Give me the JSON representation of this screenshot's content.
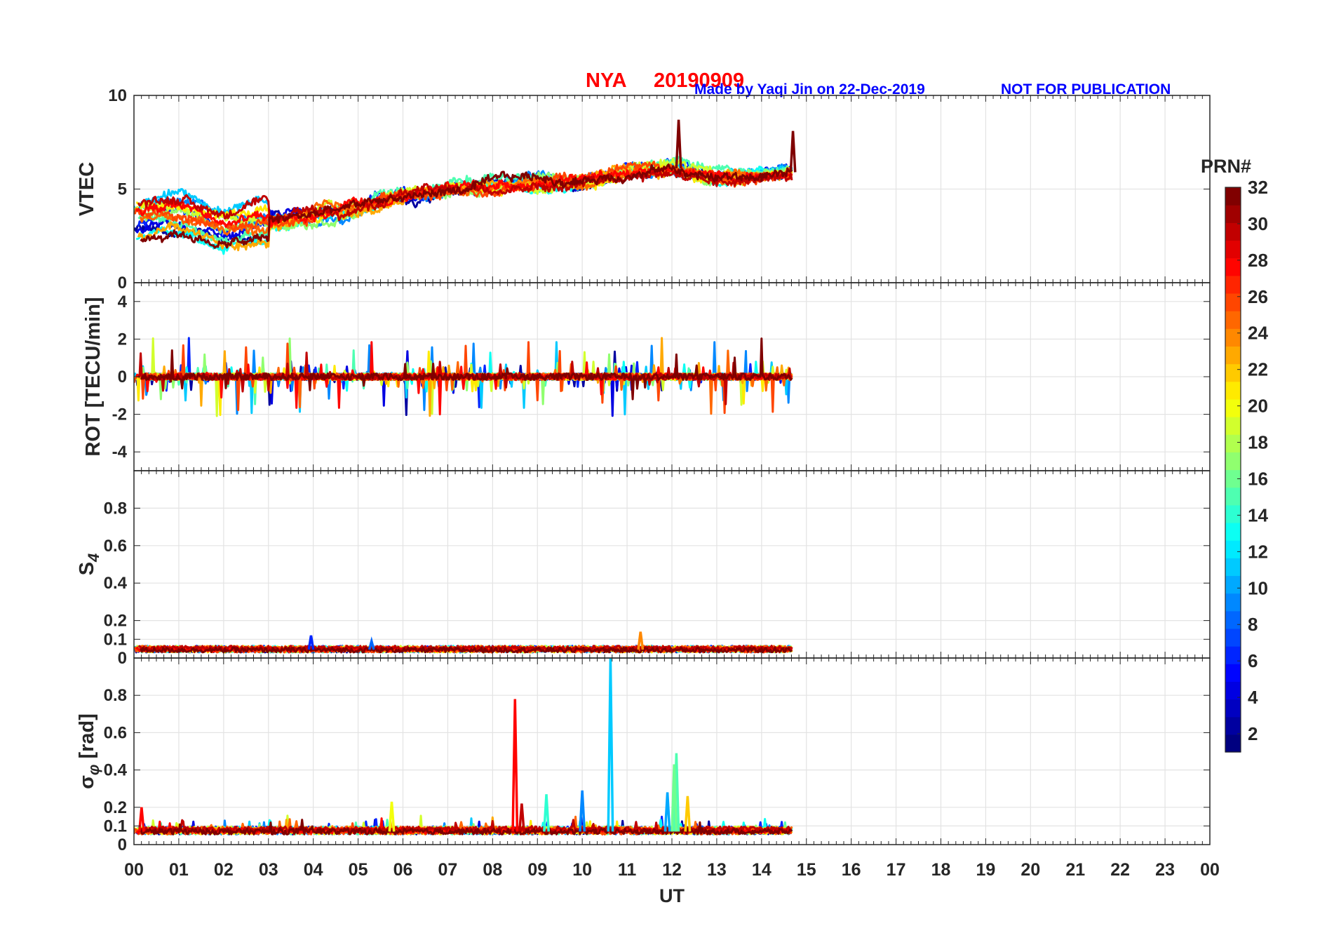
{
  "header": {
    "station": "NYA",
    "date": "20190909",
    "credit": "Made by Yaqi Jin on 22-Dec-2019",
    "notice": "NOT FOR PUBLICATION"
  },
  "colors": {
    "station_title": "#ff0000",
    "credit_text": "#0000ff",
    "grid": "#e3e3e3",
    "axes": "#262626"
  },
  "colorbar": {
    "label": "PRN#",
    "colormap": "jet",
    "range": [
      1,
      32
    ],
    "ticks": [
      "2",
      "4",
      "6",
      "8",
      "10",
      "12",
      "14",
      "16",
      "18",
      "20",
      "22",
      "24",
      "26",
      "28",
      "30",
      "32"
    ]
  },
  "chart_data": [
    {
      "type": "line",
      "ylabel": "VTEC",
      "ylim": [
        0,
        10
      ],
      "yticks": [
        "0",
        "5",
        "10"
      ],
      "xlim": [
        0,
        24
      ],
      "grid": true,
      "data_extent_hours": [
        0,
        14.7
      ],
      "series_summary": "multiple PRN traces colored by PRN number",
      "trend": [
        [
          0,
          3.5
        ],
        [
          1,
          3.7
        ],
        [
          2,
          3.0
        ],
        [
          3,
          3.2
        ],
        [
          4,
          3.6
        ],
        [
          5,
          4.0
        ],
        [
          6,
          4.6
        ],
        [
          7,
          4.9
        ],
        [
          8,
          5.2
        ],
        [
          9,
          5.5
        ],
        [
          10,
          5.4
        ],
        [
          11,
          6.0
        ],
        [
          12,
          6.2
        ],
        [
          13,
          5.6
        ],
        [
          14,
          5.7
        ],
        [
          14.7,
          5.9
        ]
      ],
      "annotations": [
        {
          "x": 12.15,
          "y": 8.7,
          "prn": 32
        },
        {
          "x": 14.7,
          "y": 8.1,
          "prn": 32
        }
      ]
    },
    {
      "type": "line",
      "ylabel": "ROT [TECU/min]",
      "ylim": [
        -5,
        5
      ],
      "yticks": [
        "-4",
        "-2",
        "0",
        "2",
        "4"
      ],
      "xlim": [
        0,
        24
      ],
      "grid": true,
      "data_extent_hours": [
        0,
        14.7
      ],
      "series_summary": "noise around 0 with spikes up to about ±3 TECU/min"
    },
    {
      "type": "line",
      "ylabel": "S",
      "ylabel_subscript": "4",
      "ylim": [
        0,
        1
      ],
      "yticks": [
        "0",
        "0.1",
        "0.2",
        "0.4",
        "0.6",
        "0.8"
      ],
      "xlim": [
        0,
        24
      ],
      "grid": true,
      "data_extent_hours": [
        0,
        14.7
      ],
      "series_summary": "baseline about 0.03-0.06",
      "peaks": [
        {
          "x": 3.95,
          "y": 0.12,
          "prn": 6
        },
        {
          "x": 5.3,
          "y": 0.09,
          "prn": 8
        },
        {
          "x": 11.3,
          "y": 0.14,
          "prn": 24
        }
      ]
    },
    {
      "type": "line",
      "ylabel": "σ",
      "ylabel_subscript": "φ",
      "ylabel_suffix": "[rad]",
      "ylim": [
        0,
        1
      ],
      "yticks": [
        "0",
        "0.1",
        "0.2",
        "0.4",
        "0.6",
        "0.8"
      ],
      "xlim": [
        0,
        24
      ],
      "grid": true,
      "data_extent_hours": [
        0,
        14.7
      ],
      "series_summary": "baseline about 0.05-0.08",
      "peaks": [
        {
          "x": 8.5,
          "y": 0.78,
          "prn": 28
        },
        {
          "x": 10.63,
          "y": 1.0,
          "prn": 11
        },
        {
          "x": 12.1,
          "y": 0.49,
          "prn": 15
        },
        {
          "x": 12.05,
          "y": 0.43,
          "prn": 16
        },
        {
          "x": 8.65,
          "y": 0.22,
          "prn": 30
        },
        {
          "x": 9.2,
          "y": 0.27,
          "prn": 14
        },
        {
          "x": 10.0,
          "y": 0.29,
          "prn": 9
        },
        {
          "x": 11.9,
          "y": 0.28,
          "prn": 10
        },
        {
          "x": 12.35,
          "y": 0.26,
          "prn": 22
        },
        {
          "x": 5.75,
          "y": 0.23,
          "prn": 20
        },
        {
          "x": 0.17,
          "y": 0.2,
          "prn": 28
        }
      ]
    }
  ],
  "xaxis": {
    "label": "UT",
    "ticks": [
      "00",
      "01",
      "02",
      "03",
      "04",
      "05",
      "06",
      "07",
      "08",
      "09",
      "10",
      "11",
      "12",
      "13",
      "14",
      "15",
      "16",
      "17",
      "18",
      "19",
      "20",
      "21",
      "22",
      "23",
      "00"
    ]
  }
}
